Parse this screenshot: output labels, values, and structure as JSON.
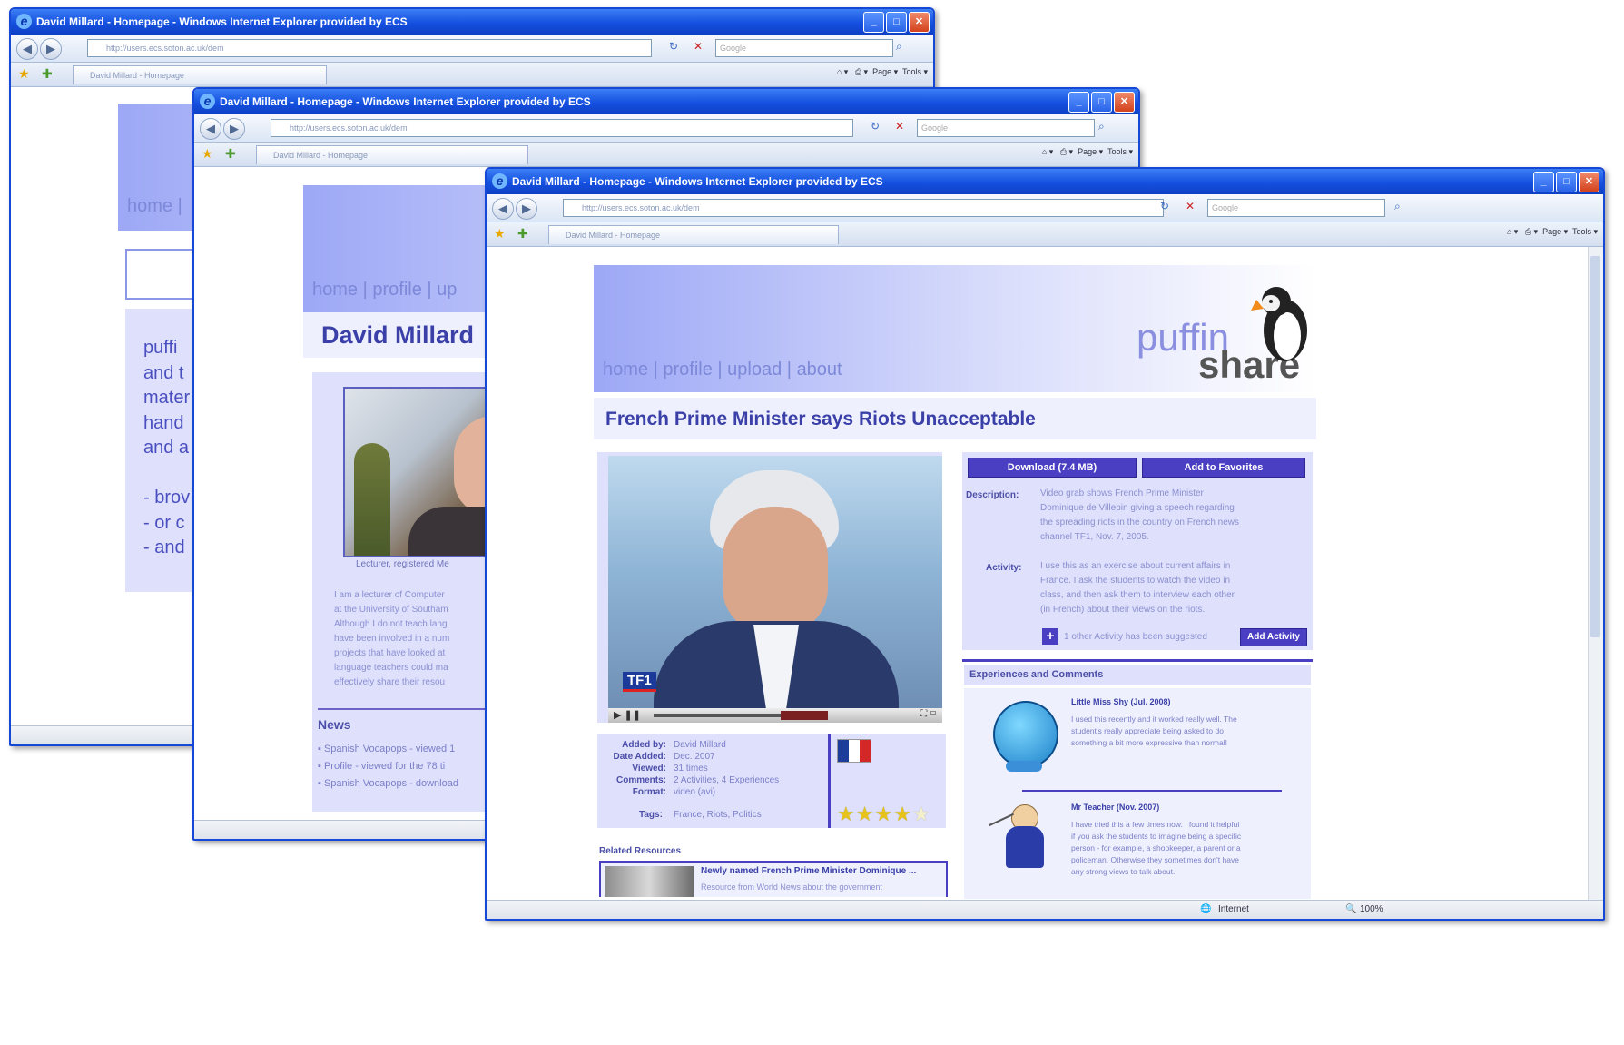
{
  "windows": {
    "back": {
      "nav": {
        "home": "home",
        "sep": "|"
      },
      "intro_lines": [
        "puffi",
        "and t",
        "mater",
        "hand",
        "and a",
        "",
        "- brov",
        "- or c",
        "- and"
      ]
    },
    "middle": {
      "nav": {
        "home": "home",
        "sep1": "|",
        "profile": "profile",
        "sep2": "|",
        "upload": "up"
      },
      "title": "David Millard",
      "photo_caption": "Lecturer, registered Me",
      "bio_lines": [
        "I am a lecturer of Computer",
        "at the University of Southam",
        "Although I do not teach lang",
        "have been involved in a num",
        "projects that have looked at",
        "language teachers could ma",
        "effectively share their resou"
      ],
      "news_heading": "News",
      "news_items": [
        "Spanish Vocapops - viewed 1",
        "Profile - viewed for the 78 ti",
        "Spanish Vocapops - download"
      ]
    },
    "front": {
      "logo": {
        "word1": "puffin",
        "word2": "share"
      },
      "nav": {
        "home": "home",
        "sep1": "|",
        "profile": "profile",
        "sep2": "|",
        "upload": "upload",
        "sep3": "|",
        "about": "about"
      },
      "title": "French Prime Minister says Riots Unacceptable",
      "video_watermark": "TF1",
      "buttons": {
        "download": "Download (7.4 MB)",
        "favorites": "Add to Favorites",
        "add_activity": "Add Activity"
      },
      "description_label": "Description:",
      "description_lines": [
        "Video grab shows French Prime Minister",
        "Dominique de Villepin giving a speech regarding",
        "the spreading riots in the country on French news",
        "channel TF1, Nov. 7, 2005."
      ],
      "activity_label": "Activity:",
      "activity_lines": [
        "I use this as an exercise about current affairs in",
        "France. I ask the students to watch the video in",
        "class, and then ask them to interview each other",
        "(in French) about their views on the riots."
      ],
      "activity_suggested": "1 other Activity has been suggested",
      "meta": [
        {
          "label": "Added by:",
          "value": "David Millard"
        },
        {
          "label": "Date Added:",
          "value": "Dec. 2007"
        },
        {
          "label": "Viewed:",
          "value": "31 times"
        },
        {
          "label": "Comments:",
          "value": "2 Activities, 4 Experiences"
        },
        {
          "label": "Format:",
          "value": "video (avi)"
        }
      ],
      "tags_label": "Tags:",
      "tags_value": "France, Riots, Politics",
      "rating_stars": 4,
      "rating_max": 5,
      "related_heading": "Related Resources",
      "related_title": "Newly named French Prime Minister Dominique ...",
      "related_sub": "Resource from World News about the government",
      "experiences_heading": "Experiences and Comments",
      "comments": [
        {
          "author": "Little Miss Shy (Jul. 2008)",
          "lines": [
            "I used this recently and it worked really well. The",
            "student's really appreciate being asked to do",
            "something a bit more expressive than normal!"
          ]
        },
        {
          "author": "Mr Teacher (Nov. 2007)",
          "lines": [
            "I have tried this a few times now. I found it helpful",
            "if you ask the students to imagine being a specific",
            "person - for example, a shopkeeper, a parent or a",
            "policeman. Otherwise they sometimes don't have",
            "any strong views to talk about."
          ]
        }
      ],
      "status": {
        "zone": "Internet",
        "zoom": "100%"
      }
    }
  },
  "browser": {
    "window_title": "David Millard - Homepage - Windows Internet Explorer provided by ECS",
    "url": "http://users.ecs.soton.ac.uk/dem",
    "search_placeholder": "Google",
    "tab_title": "David Millard - Homepage",
    "page_tool": "Page",
    "tools_tool": "Tools"
  },
  "colors": {
    "accent": "#4a3ec3",
    "panel": "#dfe1fc",
    "nav_text": "#7c88d8",
    "title_text": "#3a40a8",
    "ie_title": "#1550e0"
  }
}
